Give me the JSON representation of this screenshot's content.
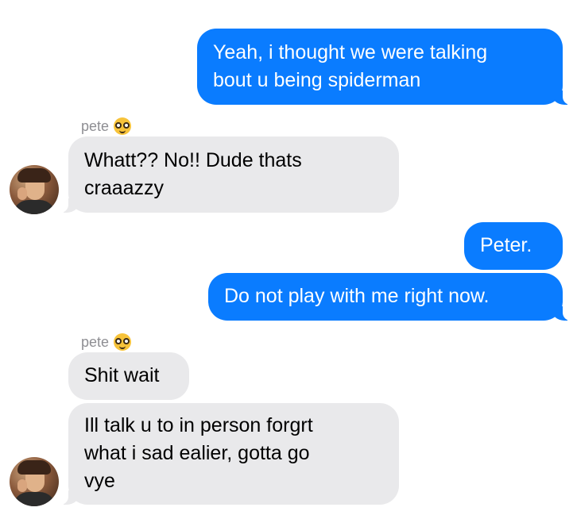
{
  "thread": {
    "messages": [
      {
        "from": "me",
        "text": "Yeah, i thought we were talking\nbout u being spiderman"
      },
      {
        "from": "pete",
        "sender_label": "pete",
        "sender_emoji": "nerd-face",
        "text": "Whatt?? No!! Dude thats\ncraaazzy"
      },
      {
        "from": "me",
        "text": "Peter."
      },
      {
        "from": "me",
        "text": "Do not play with me right now."
      },
      {
        "from": "pete",
        "sender_label": "pete",
        "sender_emoji": "nerd-face",
        "text": "Shit wait"
      },
      {
        "from": "pete",
        "text": "Ill talk u to in person forgrt\nwhat i sad ealier, gotta go\nvye"
      }
    ]
  },
  "colors": {
    "outgoing_bubble": "#0a7cff",
    "incoming_bubble": "#e9e9eb",
    "sender_label": "#8e8e93"
  }
}
